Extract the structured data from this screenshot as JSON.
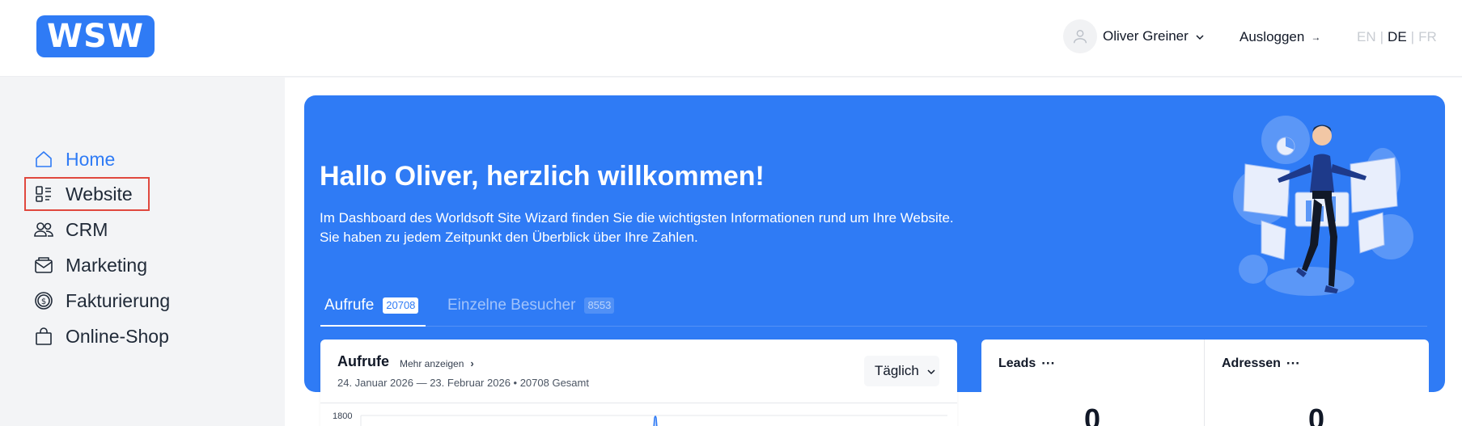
{
  "header": {
    "logo_text": "WSW",
    "user_name": "Oliver Greiner",
    "logout_label": "Ausloggen",
    "languages": [
      "EN",
      "DE",
      "FR"
    ],
    "active_language": "DE"
  },
  "sidebar": {
    "items": [
      {
        "label": "Home",
        "icon": "home-icon"
      },
      {
        "label": "Website",
        "icon": "website-layout-icon"
      },
      {
        "label": "CRM",
        "icon": "users-icon"
      },
      {
        "label": "Marketing",
        "icon": "mail-icon"
      },
      {
        "label": "Fakturierung",
        "icon": "dollar-coin-icon"
      },
      {
        "label": "Online-Shop",
        "icon": "shopping-bag-icon"
      }
    ],
    "selected_item": "Website"
  },
  "hero": {
    "title": "Hallo Oliver, herzlich willkommen!",
    "text_line1": "Im Dashboard des Worldsoft Site Wizard finden Sie die wichtigsten Informationen rund um Ihre Website.",
    "text_line2": "Sie haben zu jedem Zeitpunkt den Überblick über Ihre Zahlen.",
    "illustration": "man-with-dashboard-screens-illustration"
  },
  "tabs": [
    {
      "label": "Aufrufe",
      "badge": "20708",
      "active": true
    },
    {
      "label": "Einzelne Besucher",
      "badge": "8553",
      "active": false
    }
  ],
  "aufrufe_card": {
    "title": "Aufrufe",
    "more_label": "Mehr anzeigen",
    "subtitle": "24. Januar 2026 — 23. Februar 2026 • 20708 Gesamt",
    "period_select": "Täglich",
    "y_tick_top": "1800"
  },
  "leads_card": {
    "title": "Leads",
    "value": "0"
  },
  "adressen_card": {
    "title": "Adressen",
    "value": "0"
  },
  "colors": {
    "accent": "#2f7bf5",
    "selection_outline": "#e0483e"
  }
}
